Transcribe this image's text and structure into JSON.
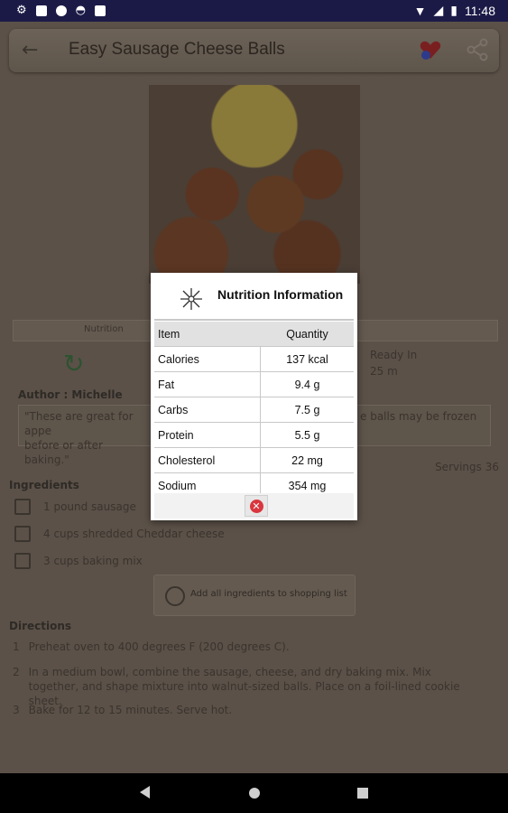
{
  "status_bar": {
    "time": "11:48",
    "icons_left": [
      "settings-icon",
      "notification-a-icon",
      "circle-icon",
      "cast-icon",
      "sd-card-icon"
    ],
    "icons_right": [
      "wifi-icon",
      "signal-icon",
      "battery-icon"
    ]
  },
  "toolbar": {
    "title": "Easy Sausage Cheese Balls",
    "back_icon": "arrow-left-icon",
    "favorite_icon": "heart-icon",
    "share_icon": "share-icon"
  },
  "recipe": {
    "tab_label": "Nutrition",
    "ready_in_label": "Ready In",
    "ready_in_value": "25 m",
    "author": "Author : Michelle",
    "description_left": "\"These are great for appe",
    "description_left_2": "before or after baking.\"",
    "description_right": "e balls may be frozen",
    "servings": "Servings 36",
    "ingredients_heading": "Ingredients",
    "ingredients": [
      "1 pound sausage",
      "4 cups shredded Cheddar cheese",
      "3 cups baking mix"
    ],
    "add_to_list_label": "Add all ingredients to shopping list",
    "directions_heading": "Directions",
    "directions": [
      {
        "num": "1",
        "text": "Preheat oven to 400 degrees F (200 degrees C)."
      },
      {
        "num": "2",
        "text": "In a medium bowl, combine the sausage, cheese, and dry baking mix. Mix together, and shape mixture into walnut-sized balls. Place on a foil-lined cookie sheet."
      },
      {
        "num": "3",
        "text": "Bake for 12 to 15 minutes. Serve hot."
      }
    ]
  },
  "dialog": {
    "title": "Nutrition Information",
    "header_item": "Item",
    "header_quantity": "Quantity",
    "rows": [
      {
        "item": "Calories",
        "quantity": "137 kcal"
      },
      {
        "item": "Fat",
        "quantity": "9.4 g"
      },
      {
        "item": "Carbs",
        "quantity": "7.5 g"
      },
      {
        "item": "Protein",
        "quantity": "5.5 g"
      },
      {
        "item": "Cholesterol",
        "quantity": "22 mg"
      },
      {
        "item": "Sodium",
        "quantity": "354 mg"
      }
    ],
    "close_icon": "close-icon",
    "close_color": "#d9363e"
  },
  "colors": {
    "status_bar": "#1b1a47",
    "overlay_dim": "#5b5148",
    "dialog_bg": "#ffffff"
  }
}
